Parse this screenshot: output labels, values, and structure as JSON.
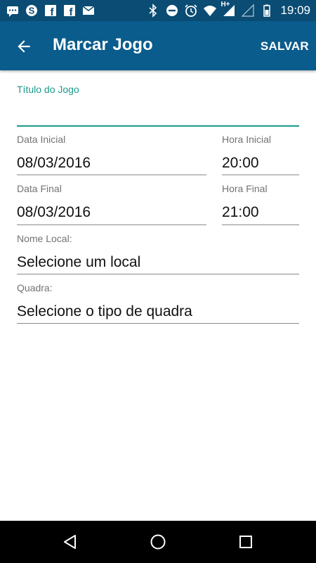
{
  "status_bar": {
    "time": "19:09",
    "network": "H+",
    "left_icons": [
      "chat-bubble-icon",
      "skype-icon",
      "facebook-icon",
      "facebook-icon",
      "mail-icon"
    ],
    "right_icons": [
      "bluetooth-icon",
      "do-not-disturb-icon",
      "alarm-icon",
      "wifi-icon",
      "signal-icon",
      "signal-icon",
      "battery-icon"
    ]
  },
  "toolbar": {
    "title": "Marcar Jogo",
    "save_label": "SALVAR",
    "back_icon": "arrow-back-icon"
  },
  "form": {
    "title_field": {
      "label": "Título do Jogo",
      "value": ""
    },
    "start_date": {
      "label": "Data Inicial",
      "value": "08/03/2016"
    },
    "start_time": {
      "label": "Hora Inicial",
      "value": "20:00"
    },
    "end_date": {
      "label": "Data Final",
      "value": "08/03/2016"
    },
    "end_time": {
      "label": "Hora Final",
      "value": "21:00"
    },
    "location": {
      "label": "Nome Local:",
      "value": "Selecione um local"
    },
    "court": {
      "label": "Quadra:",
      "value": "Selecione o tipo de quadra"
    }
  },
  "colors": {
    "status_bar": "#0a4c73",
    "toolbar": "#0a5c8c",
    "accent": "#1a9a8a"
  },
  "nav_bar": {
    "icons": [
      "back-triangle-icon",
      "home-circle-icon",
      "recents-square-icon"
    ]
  }
}
